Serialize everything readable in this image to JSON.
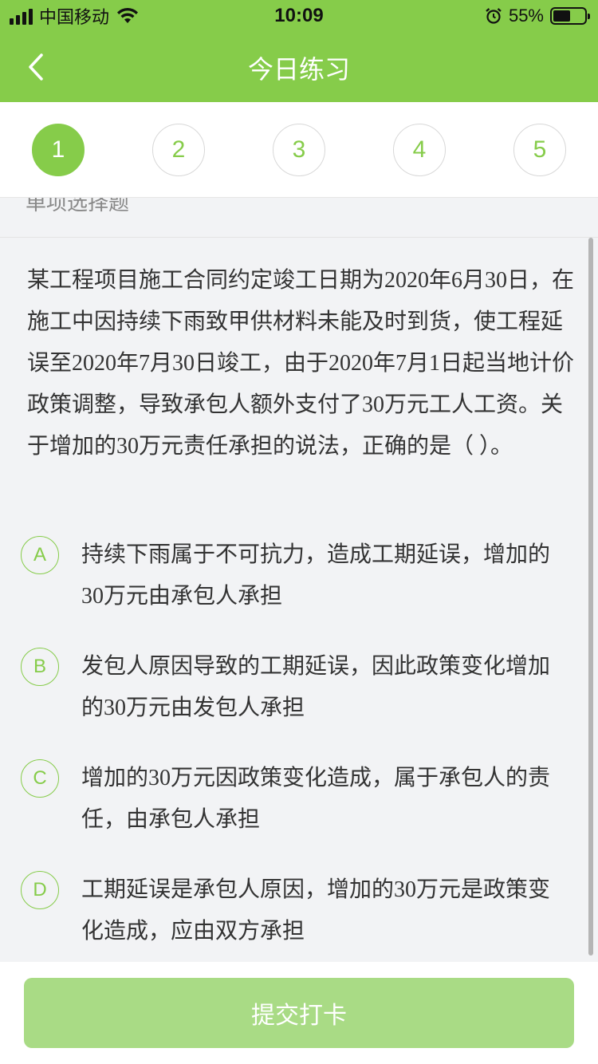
{
  "status_bar": {
    "carrier": "中国移动",
    "time": "10:09",
    "battery_percent": "55%",
    "battery_level": 0.55
  },
  "nav": {
    "title": "今日练习",
    "back_icon": "chevron-left-icon"
  },
  "steps": [
    {
      "label": "1",
      "active": true
    },
    {
      "label": "2",
      "active": false
    },
    {
      "label": "3",
      "active": false
    },
    {
      "label": "4",
      "active": false
    },
    {
      "label": "5",
      "active": false
    }
  ],
  "section_label": "单项选择题",
  "question": "某工程项目施工合同约定竣工日期为2020年6月30日，在施工中因持续下雨致甲供材料未能及时到货，使工程延误至2020年7月30日竣工，由于2020年7月1日起当地计价政策调整，导致承包人额外支付了30万元工人工资。关于增加的30万元责任承担的说法，正确的是（    ）。",
  "options": [
    {
      "letter": "A",
      "text": "持续下雨属于不可抗力，造成工期延误，增加的30万元由承包人承担"
    },
    {
      "letter": "B",
      "text": "发包人原因导致的工期延误，因此政策变化增加的30万元由发包人承担"
    },
    {
      "letter": "C",
      "text": "增加的30万元因政策变化造成，属于承包人的责任，由承包人承担"
    },
    {
      "letter": "D",
      "text": "工期延误是承包人原因，增加的30万元是政策变化造成，应由双方承担"
    }
  ],
  "footer": {
    "submit_label": "提交打卡"
  },
  "colors": {
    "brand_green": "#86cc4a",
    "button_green_disabled": "#a9db85"
  }
}
